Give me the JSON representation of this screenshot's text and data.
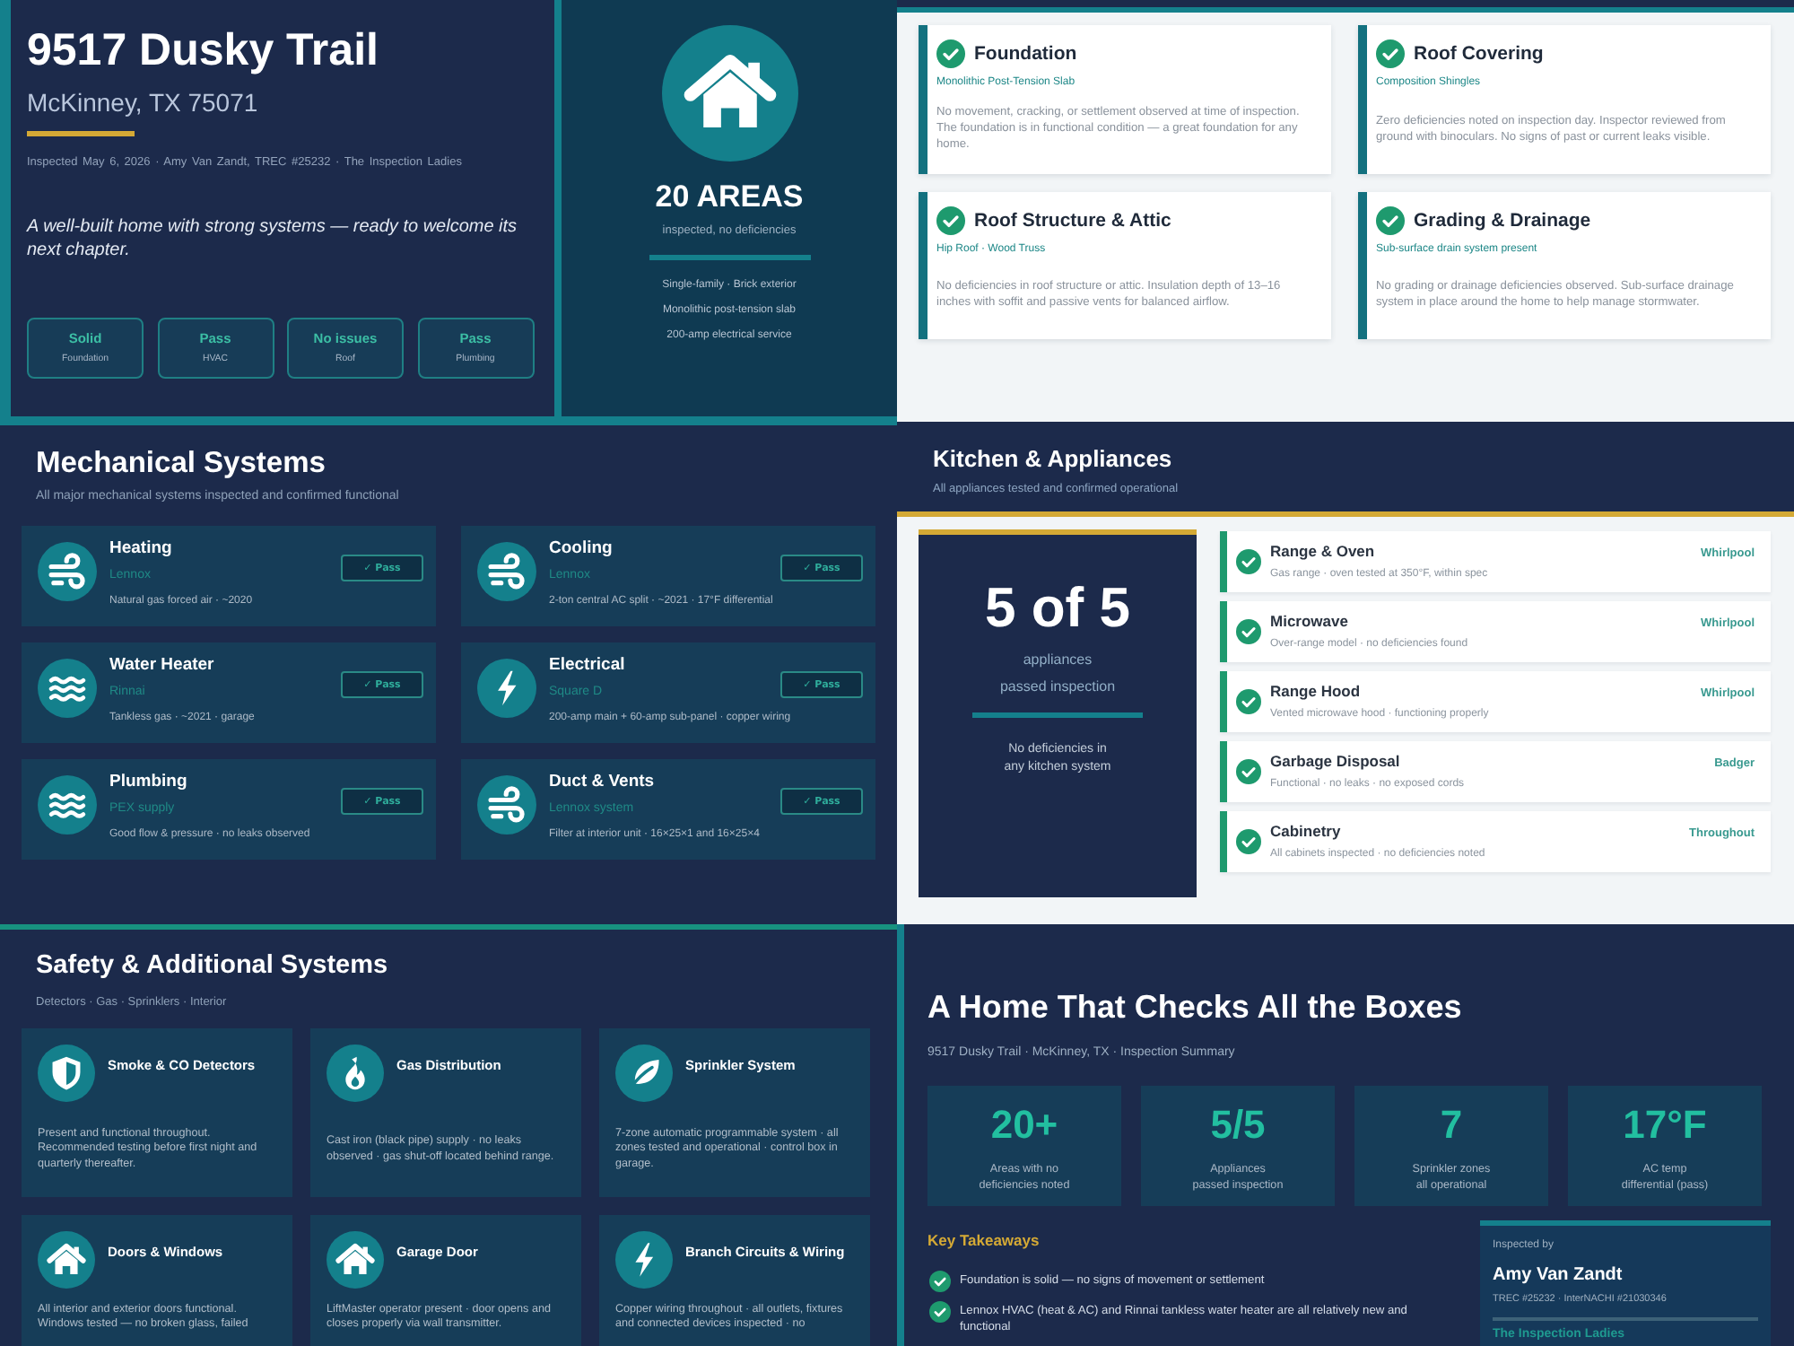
{
  "hero": {
    "title": "9517 Dusky Trail",
    "location": "McKinney, TX 75071",
    "meta": "Inspected May 6, 2026 · Amy Van Zandt, TREC #25232 · The Inspection Ladies",
    "tagline": "A well-built home with strong systems — ready to welcome its next chapter.",
    "stats": [
      {
        "value": "Solid",
        "label": "Foundation"
      },
      {
        "value": "Pass",
        "label": "HVAC"
      },
      {
        "value": "No issues",
        "label": "Roof"
      },
      {
        "value": "Pass",
        "label": "Plumbing"
      }
    ]
  },
  "hero_summary": {
    "headline": "20 AREAS",
    "caption": "inspected, no deficiencies",
    "facts": [
      "Single-family · Brick exterior",
      "Monolithic post-tension slab",
      "200-amp electrical service"
    ]
  },
  "structure": {
    "cards": [
      {
        "title": "Foundation",
        "subtitle": "Monolithic Post-Tension Slab",
        "body": "No movement, cracking, or settlement observed at time of inspection. The foundation is in functional condition — a great foundation for any home.",
        "passed": true
      },
      {
        "title": "Roof Covering",
        "subtitle": "Composition Shingles",
        "body": "Zero deficiencies noted on inspection day. Inspector reviewed from ground with binoculars. No signs of past or current leaks visible.",
        "passed": true
      },
      {
        "title": "Roof Structure & Attic",
        "subtitle": "Hip Roof · Wood Truss",
        "body": "No deficiencies in roof structure or attic. Insulation depth of 13–16 inches with soffit and passive vents for balanced airflow.",
        "passed": true
      },
      {
        "title": "Grading & Drainage",
        "subtitle": "Sub-surface drain system present",
        "body": "No grading or drainage deficiencies observed. Sub-surface drainage system in place around the home to help manage stormwater.",
        "passed": true
      }
    ]
  },
  "mechanical": {
    "title": "Mechanical Systems",
    "subtitle": "All major mechanical systems inspected and confirmed functional",
    "systems": [
      {
        "kind": "air",
        "name": "Heating",
        "brand": "Lennox",
        "detail": "Natural gas forced air · ~2020",
        "badge": "✓ Pass"
      },
      {
        "kind": "air",
        "name": "Cooling",
        "brand": "Lennox",
        "detail": "2-ton central AC split · ~2021 · 17°F differential",
        "badge": "✓ Pass"
      },
      {
        "kind": "water",
        "name": "Water Heater",
        "brand": "Rinnai",
        "detail": "Tankless gas · ~2021 · garage",
        "badge": "✓ Pass"
      },
      {
        "kind": "electric",
        "name": "Electrical",
        "brand": "Square D",
        "detail": "200-amp main + 60-amp sub-panel · copper wiring",
        "badge": "✓ Pass"
      },
      {
        "kind": "water",
        "name": "Plumbing",
        "brand": "PEX supply",
        "detail": "Good flow & pressure · no leaks observed",
        "badge": "✓ Pass"
      },
      {
        "kind": "air",
        "name": "Duct & Vents",
        "brand": "Lennox system",
        "detail": "Filter at interior unit · 16×25×1 and 16×25×4",
        "badge": "✓ Pass"
      }
    ]
  },
  "kitchen": {
    "title": "Kitchen & Appliances",
    "subtitle": "All appliances tested and confirmed operational",
    "summary": {
      "count": "5 of 5",
      "caption_lines": [
        "appliances",
        "passed inspection"
      ],
      "note_lines": [
        "No deficiencies in",
        "any kitchen system"
      ]
    },
    "appliances": [
      {
        "name": "Range & Oven",
        "detail": "Gas range · oven tested at 350°F, within spec",
        "brand": "Whirlpool",
        "passed": true
      },
      {
        "name": "Microwave",
        "detail": "Over-range model · no deficiencies found",
        "brand": "Whirlpool",
        "passed": true
      },
      {
        "name": "Range Hood",
        "detail": "Vented microwave hood · functioning properly",
        "brand": "Whirlpool",
        "passed": true
      },
      {
        "name": "Garbage Disposal",
        "detail": "Functional · no leaks · no exposed cords",
        "brand": "Badger",
        "passed": true
      },
      {
        "name": "Cabinetry",
        "detail": "All cabinets inspected · no deficiencies noted",
        "brand": "Throughout",
        "passed": true
      }
    ]
  },
  "safety": {
    "title": "Safety & Additional Systems",
    "subtitle": "Detectors · Gas · Sprinklers · Interior",
    "systems": [
      {
        "kind": "detector",
        "name": "Smoke & CO Detectors",
        "detail": "Present and functional throughout. Recommended testing before first night and quarterly thereafter."
      },
      {
        "kind": "gas",
        "name": "Gas Distribution",
        "detail": "Cast iron (black pipe) supply · no leaks observed · gas shut-off located behind range."
      },
      {
        "kind": "irrigation",
        "name": "Sprinkler System",
        "detail": "7-zone automatic programmable system · all zones tested and operational · control box in garage."
      },
      {
        "kind": "home",
        "name": "Doors & Windows",
        "detail": "All interior and exterior doors functional. Windows tested — no broken glass, failed"
      },
      {
        "kind": "home",
        "name": "Garage Door",
        "detail": "LiftMaster operator present · door opens and closes properly via wall transmitter."
      },
      {
        "kind": "electric",
        "name": "Branch Circuits & Wiring",
        "detail": "Copper wiring throughout · all outlets, fixtures and connected devices inspected · no"
      }
    ]
  },
  "summary": {
    "title": "A Home That Checks All the Boxes",
    "subtitle": "9517 Dusky Trail · McKinney, TX · Inspection Summary",
    "stats": [
      {
        "value": "20+",
        "label_lines": [
          "Areas with no",
          "deficiencies noted"
        ]
      },
      {
        "value": "5/5",
        "label_lines": [
          "Appliances",
          "passed inspection"
        ]
      },
      {
        "value": "7",
        "label_lines": [
          "Sprinkler zones",
          "all operational"
        ]
      },
      {
        "value": "17°F",
        "label_lines": [
          "AC temp",
          "differential (pass)"
        ]
      }
    ],
    "takeaways_title": "Key Takeaways",
    "takeaways": [
      {
        "text": "Foundation is solid — no signs of movement or settlement",
        "passed": true
      },
      {
        "text": "Lennox HVAC (heat & AC) and Rinnai tankless water heater are all relatively new and functional",
        "passed": true
      }
    ],
    "inspector": {
      "heading": "Inspected by",
      "name": "Amy Van Zandt",
      "credentials": "TREC #25232 · InterNACHI #21030346",
      "company": "The Inspection Ladies"
    }
  }
}
